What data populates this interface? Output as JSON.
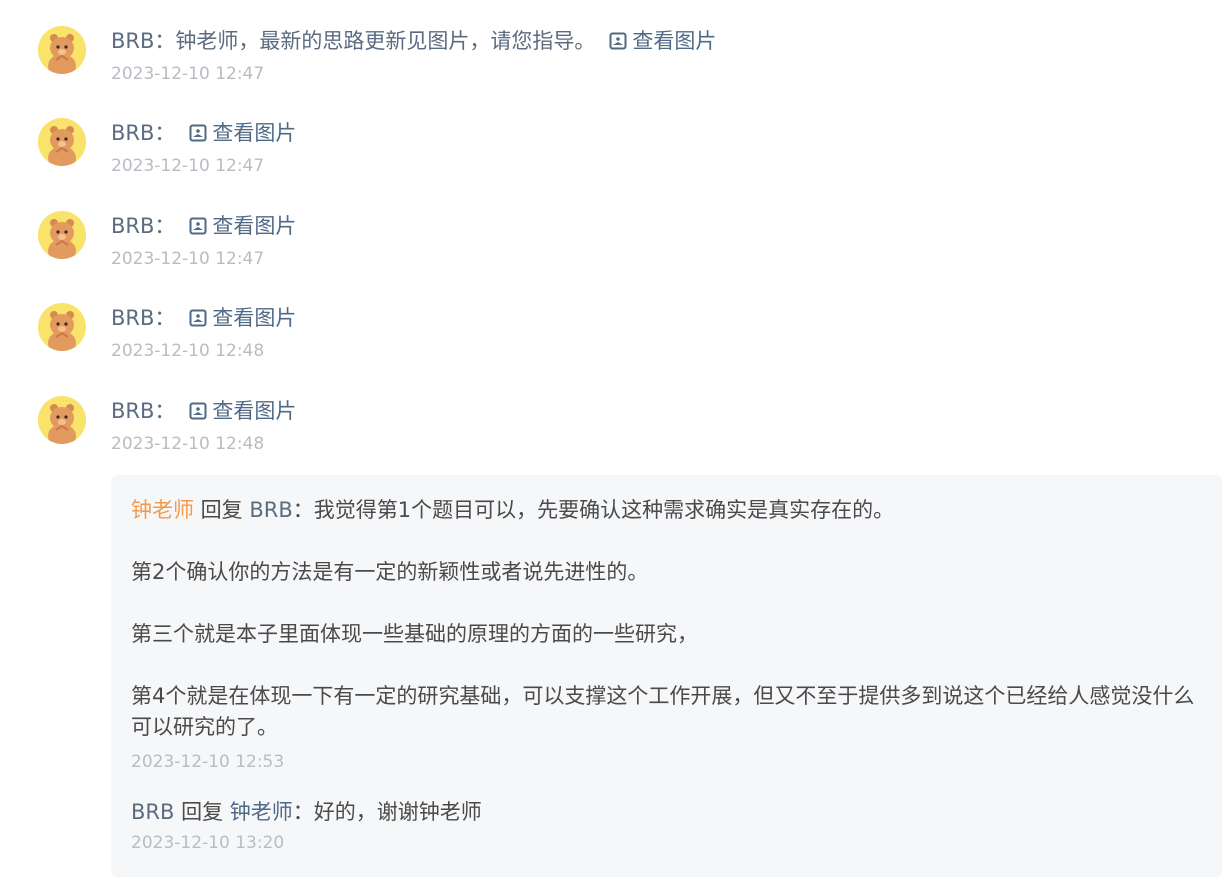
{
  "messages": [
    {
      "author": "BRB",
      "sep": "：",
      "text": "钟老师，最新的思路更新见图片，请您指导。",
      "link": "查看图片",
      "time": "2023-12-10 12:47"
    },
    {
      "author": "BRB",
      "sep": "：",
      "text": "",
      "link": "查看图片",
      "time": "2023-12-10 12:47"
    },
    {
      "author": "BRB",
      "sep": "：",
      "text": "",
      "link": "查看图片",
      "time": "2023-12-10 12:47"
    },
    {
      "author": "BRB",
      "sep": "：",
      "text": "",
      "link": "查看图片",
      "time": "2023-12-10 12:48"
    },
    {
      "author": "BRB",
      "sep": "：",
      "text": "",
      "link": "查看图片",
      "time": "2023-12-10 12:48"
    }
  ],
  "reply1": {
    "from": "钟老师",
    "verb": " 回复 ",
    "to": "BRB",
    "sep": "：",
    "p1": "我觉得第1个题目可以，先要确认这种需求确实是真实存在的。",
    "p2": "第2个确认你的方法是有一定的新颖性或者说先进性的。",
    "p3": "第三个就是本子里面体现一些基础的原理的方面的一些研究，",
    "p4": "第4个就是在体现一下有一定的研究基础，可以支撑这个工作开展，但又不至于提供多到说这个已经给人感觉没什么可以研究的了。",
    "time": "2023-12-10 12:53"
  },
  "reply2": {
    "from": "BRB",
    "verb": " 回复 ",
    "to": "钟老师",
    "sep": "：",
    "text": "好的，谢谢钟老师",
    "time": "2023-12-10 13:20"
  },
  "icons": {
    "avatar": "bear-avatar-icon",
    "image": "image-icon"
  },
  "colors": {
    "name": "#5b6b80",
    "link": "#4f6a86",
    "orange": "#f39a4a",
    "time": "#b8bcc3",
    "box": "#f6f7f9"
  }
}
